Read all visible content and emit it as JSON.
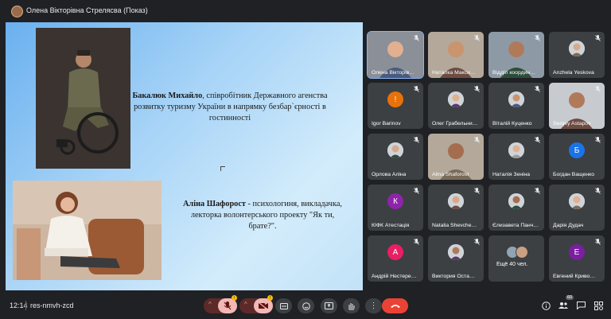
{
  "header": {
    "presenter": "Олена Вікторівна Стрелясва (Показ)"
  },
  "slide": {
    "caption1_name": "Бакалюк Михайло",
    "caption1_text": ", співробітник Державного агенства розвитку туризму України в напрямку безбар`єрності в гостинності",
    "caption2_name": "Аліна Шафорост",
    "caption2_text": " - психологиня, викладачка, лекторка волонтерського проекту \"Як ти, брате?\"."
  },
  "participants": [
    {
      "name": "Олена Вікторів…",
      "kind": "video",
      "active": true
    },
    {
      "name": "Наталка Макси…",
      "kind": "video"
    },
    {
      "name": "Відділ координ…",
      "kind": "video"
    },
    {
      "name": "Anzhela Yeskova",
      "kind": "photo"
    },
    {
      "name": "Igor Barinov",
      "kind": "letter",
      "letter": "!",
      "color": "#e8710a"
    },
    {
      "name": "Олег Грабельни…",
      "kind": "photo"
    },
    {
      "name": "Віталій Куценко",
      "kind": "photo"
    },
    {
      "name": "Sergey Astapov",
      "kind": "video"
    },
    {
      "name": "Орлова Аліна",
      "kind": "photo"
    },
    {
      "name": "Alina Shaforost",
      "kind": "video"
    },
    {
      "name": "Наталія Зеніна",
      "kind": "photo"
    },
    {
      "name": "Богдан Ващенко",
      "kind": "letter",
      "letter": "Б",
      "color": "#1a73e8"
    },
    {
      "name": "КІФК Атестація",
      "kind": "letter",
      "letter": "К",
      "color": "#8e24aa"
    },
    {
      "name": "Natalia Shevche…",
      "kind": "photo"
    },
    {
      "name": "Єлизавета Панч…",
      "kind": "photo"
    },
    {
      "name": "Дарія Дудач",
      "kind": "photo"
    },
    {
      "name": "Андрій Нестере…",
      "kind": "letter",
      "letter": "А",
      "color": "#e91e63"
    },
    {
      "name": "Виктория Оста…",
      "kind": "photo"
    },
    {
      "name": "Ещё 40 чел.",
      "kind": "more"
    },
    {
      "name": "Евгений Криво…",
      "kind": "letter",
      "letter": "Е",
      "color": "#7b1fa2"
    }
  ],
  "footer": {
    "time": "12:14",
    "meeting_code": "res-nmvh-zcd",
    "people_count": "60"
  },
  "colors": {
    "background": "#202124",
    "tile": "#3c4043",
    "end_call": "#ea4335",
    "mic_off": "#f2b8b5"
  }
}
